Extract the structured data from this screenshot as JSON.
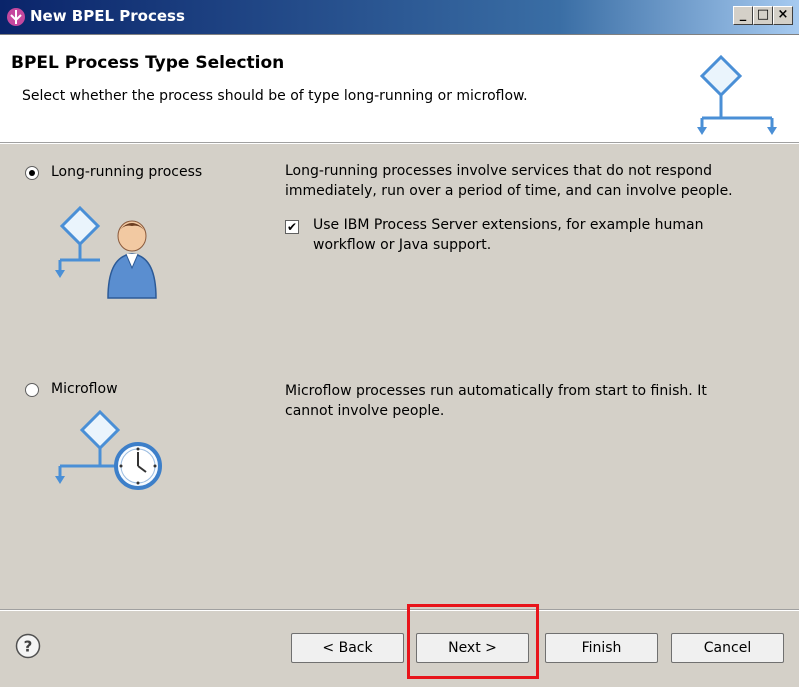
{
  "window": {
    "title": "New BPEL Process",
    "buttons": [
      "_",
      "□",
      "×"
    ]
  },
  "header": {
    "title": "BPEL Process Type Selection",
    "subtitle": "Select whether the process should be of type long-running or microflow.",
    "icon": "bpel-process-diagram-icon"
  },
  "options": [
    {
      "label": "Long-running process",
      "selected": true,
      "description_line1": "Long-running processes involve services that do not respond",
      "description_line2": "immediately, run over a period of time, and can involve people.",
      "icon": "process-person-icon",
      "checkbox": {
        "checked": true,
        "line1": "Use IBM Process Server extensions, for example human",
        "line2": "workflow or Java support."
      }
    },
    {
      "label": "Microflow",
      "selected": false,
      "description_line1": "Microflow processes run automatically from start to finish. It",
      "description_line2": "cannot involve people.",
      "icon": "process-clock-icon"
    }
  ],
  "footer": {
    "help_icon": "help-icon",
    "back_label": "< Back",
    "next_label": "Next >",
    "finish_label": "Finish",
    "cancel_label": "Cancel"
  },
  "colors": {
    "highlight": "#e8141b",
    "accent_blue": "#4a8fd6"
  }
}
